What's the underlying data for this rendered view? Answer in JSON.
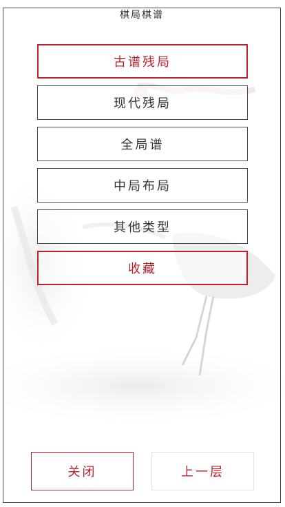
{
  "dialog": {
    "title": "棋局棋谱"
  },
  "menu": {
    "items": [
      {
        "label": "古谱残局"
      },
      {
        "label": "现代残局"
      },
      {
        "label": "全局谱"
      },
      {
        "label": "中局布局"
      },
      {
        "label": "其他类型"
      },
      {
        "label": "收藏"
      }
    ]
  },
  "footer": {
    "close_label": "关闭",
    "up_label": "上一层"
  },
  "colors": {
    "accent": "#b8232d",
    "border": "#4a4a4a"
  }
}
